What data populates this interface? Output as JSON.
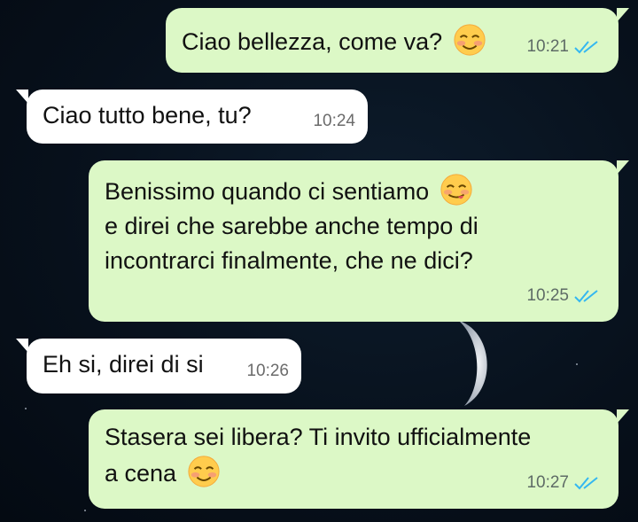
{
  "messages": [
    {
      "direction": "out",
      "lines": [
        "Ciao bellezza, come va?"
      ],
      "time": "10:21",
      "status": "read",
      "emoji": "smiling-blush-emoji"
    },
    {
      "direction": "in",
      "lines": [
        "Ciao tutto bene, tu?"
      ],
      "time": "10:24"
    },
    {
      "direction": "out",
      "lines": [
        "Benissimo quando ci sentiamo",
        "e direi che sarebbe anche tempo di",
        "incontrarci finalmente, che ne dici?"
      ],
      "time": "10:25",
      "status": "read",
      "emoji": "yum-emoji"
    },
    {
      "direction": "in",
      "lines": [
        "Eh si, direi di si"
      ],
      "time": "10:26"
    },
    {
      "direction": "out",
      "lines": [
        "Stasera sei libera? Ti invito ufficialmente",
        "a cena"
      ],
      "time": "10:27",
      "status": "read",
      "emoji": "smiling-blush-emoji"
    }
  ],
  "colors": {
    "outgoing": "#dcf8c6",
    "incoming": "#ffffff",
    "read_ticks": "#34b7f1"
  }
}
